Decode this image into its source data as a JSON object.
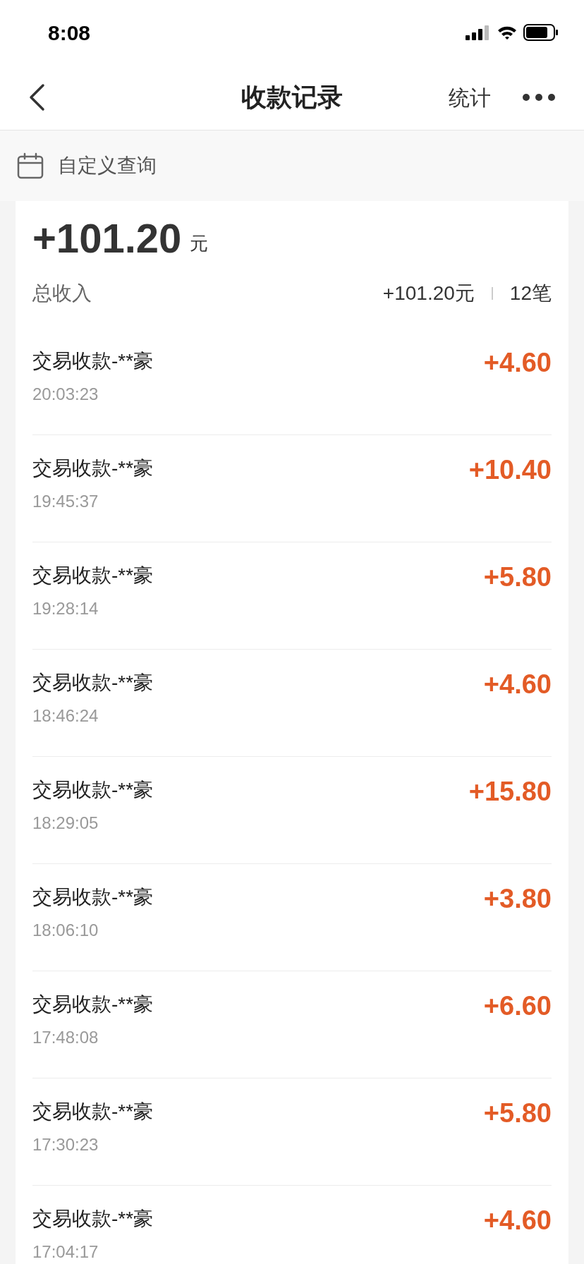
{
  "status_bar": {
    "time": "8:08"
  },
  "nav": {
    "title": "收款记录",
    "action": "统计"
  },
  "filter": {
    "label": "自定义查询"
  },
  "summary": {
    "amount": "+101.20",
    "unit": "元",
    "label": "总收入",
    "total": "+101.20元",
    "count": "12笔"
  },
  "records": [
    {
      "title": "交易收款-**豪",
      "time": "20:03:23",
      "amount": "+4.60"
    },
    {
      "title": "交易收款-**豪",
      "time": "19:45:37",
      "amount": "+10.40"
    },
    {
      "title": "交易收款-**豪",
      "time": "19:28:14",
      "amount": "+5.80"
    },
    {
      "title": "交易收款-**豪",
      "time": "18:46:24",
      "amount": "+4.60"
    },
    {
      "title": "交易收款-**豪",
      "time": "18:29:05",
      "amount": "+15.80"
    },
    {
      "title": "交易收款-**豪",
      "time": "18:06:10",
      "amount": "+3.80"
    },
    {
      "title": "交易收款-**豪",
      "time": "17:48:08",
      "amount": "+6.60"
    },
    {
      "title": "交易收款-**豪",
      "time": "17:30:23",
      "amount": "+5.80"
    },
    {
      "title": "交易收款-**豪",
      "time": "17:04:17",
      "amount": "+4.60"
    }
  ]
}
